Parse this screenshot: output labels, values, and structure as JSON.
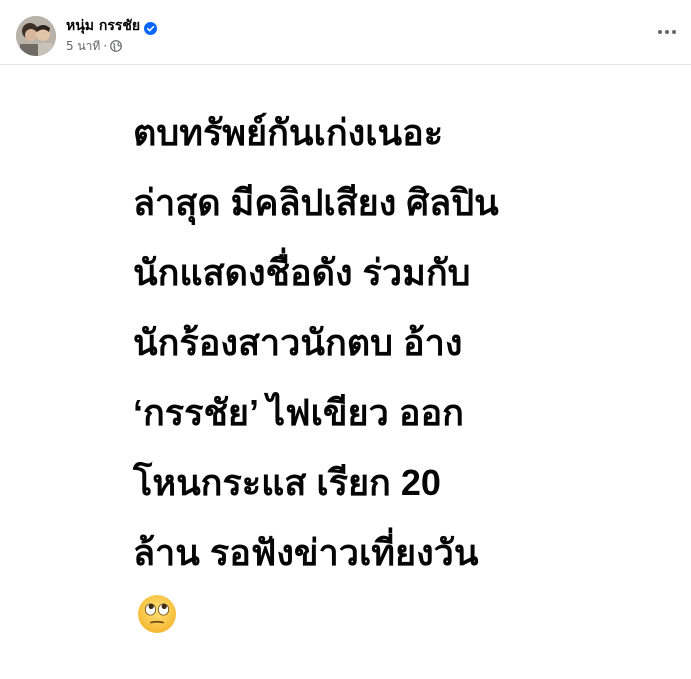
{
  "post": {
    "author": "หนุ่ม กรรชัย",
    "timestamp": "5 นาที",
    "separator": "·",
    "audience_icon": "globe-icon",
    "verified_icon": "verified-badge-icon",
    "more_icon": "more-horizontal-icon",
    "lines": [
      "ตบทรัพย์กันเก่งเนอะ",
      "ล่าสุด มีคลิปเสียง ศิลปิน",
      "นักแสดงชื่อดัง ร่วมกับ",
      "นักร้องสาวนักตบ อ้าง",
      "‘กรรชัย’ ไฟเขียว ออก",
      "โหนกระแส เรียก 20",
      "ล้าน รอฟังข่าวเที่ยงวัน"
    ],
    "emoji": "face-with-rolling-eyes-icon"
  },
  "colors": {
    "text": "#050505",
    "secondary": "#65676b",
    "verified": "#0866ff",
    "divider": "#e4e6eb"
  }
}
